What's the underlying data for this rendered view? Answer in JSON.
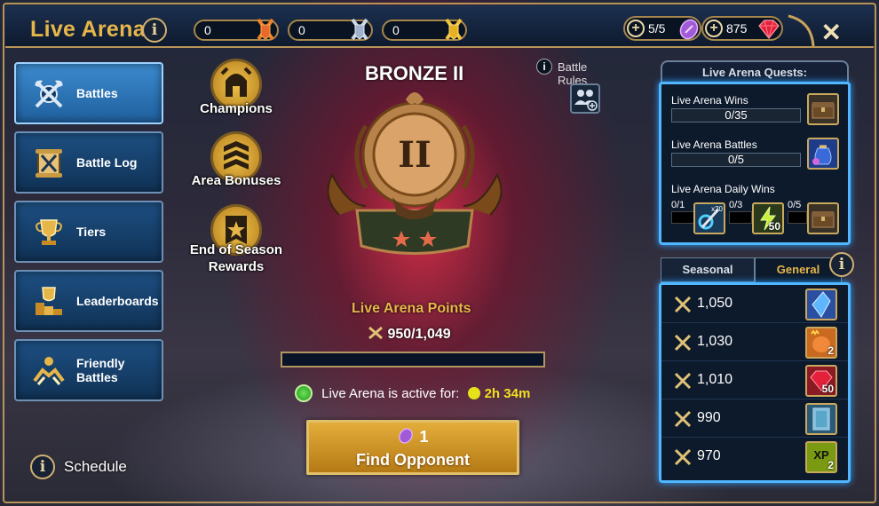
{
  "header": {
    "title": "Live Arena",
    "counters": [
      {
        "value": "0",
        "icon": "orange-crossed-swords-icon"
      },
      {
        "value": "0",
        "icon": "silver-crossed-swords-icon"
      },
      {
        "value": "0",
        "icon": "gold-crossed-swords-icon"
      }
    ],
    "tokens": "5/5",
    "gems": "875"
  },
  "sidebar": {
    "items": [
      {
        "label": "Battles",
        "icon": "crossed-axes-icon",
        "active": true
      },
      {
        "label": "Battle Log",
        "icon": "scroll-icon"
      },
      {
        "label": "Tiers",
        "icon": "trophy-cup-icon"
      },
      {
        "label": "Leaderboards",
        "icon": "trophy-podium-icon"
      },
      {
        "label": "Friendly Battles",
        "icon": "handshake-icon"
      }
    ],
    "schedule_label": "Schedule"
  },
  "center": {
    "champions_label": "Champions",
    "area_bonuses_label": "Area Bonuses",
    "end_season_label": "End of Season Rewards",
    "rank_title": "BRONZE II",
    "rank_numeral": "II",
    "battle_rules_label": "Battle Rules",
    "points_title": "Live Arena Points",
    "points_value": "950/1,049",
    "points_progress": 0,
    "active_label": "Live Arena is active for:",
    "active_time": "2h 34m",
    "find_cost": "1",
    "find_label": "Find Opponent"
  },
  "quests": {
    "title": "Live Arena Quests:",
    "items": [
      {
        "name": "Live Arena Wins",
        "progress": "0/35",
        "reward_icon": "chest-icon"
      },
      {
        "name": "Live Arena Battles",
        "progress": "0/5",
        "reward_icon": "pouch-icon"
      }
    ],
    "daily": {
      "name": "Live Arena Daily Wins",
      "steps": [
        "0/1",
        "0/3",
        "0/5"
      ],
      "rewards": [
        {
          "icon": "multi-battle-icon",
          "qty": "x20"
        },
        {
          "icon": "energy-icon",
          "qty": "50"
        },
        {
          "icon": "chest-icon",
          "qty": ""
        }
      ]
    }
  },
  "rewards": {
    "tabs": [
      "Seasonal",
      "General"
    ],
    "active_tab": "General",
    "rows": [
      {
        "points": "1,050",
        "icon": "blue-shard-icon",
        "qty": ""
      },
      {
        "points": "1,030",
        "icon": "champion-chicken-icon",
        "qty": "2"
      },
      {
        "points": "1,010",
        "icon": "ruby-gem-icon",
        "qty": "50"
      },
      {
        "points": "990",
        "icon": "tome-icon",
        "qty": ""
      },
      {
        "points": "970",
        "icon": "xp-brew-icon",
        "qty": "2"
      }
    ]
  },
  "colors": {
    "accent": "#e7b64a",
    "panel_border": "#4fb6ff",
    "active_tab": "#1f5f9c"
  }
}
